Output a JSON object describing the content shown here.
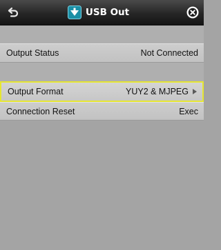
{
  "header": {
    "title": "USB Out",
    "back_icon": "back-arrow-icon",
    "title_icon": "usb-icon",
    "close_icon": "close-icon"
  },
  "settings": [
    {
      "label": "Output Status",
      "value": "Not Connected"
    },
    {
      "label": "Output Format",
      "value": "YUY2 & MJPEG"
    },
    {
      "label": "Connection Reset",
      "value": "Exec"
    }
  ],
  "colors": {
    "accent_icon": "#1a8fa6",
    "selection_outline": "#e6e632"
  }
}
